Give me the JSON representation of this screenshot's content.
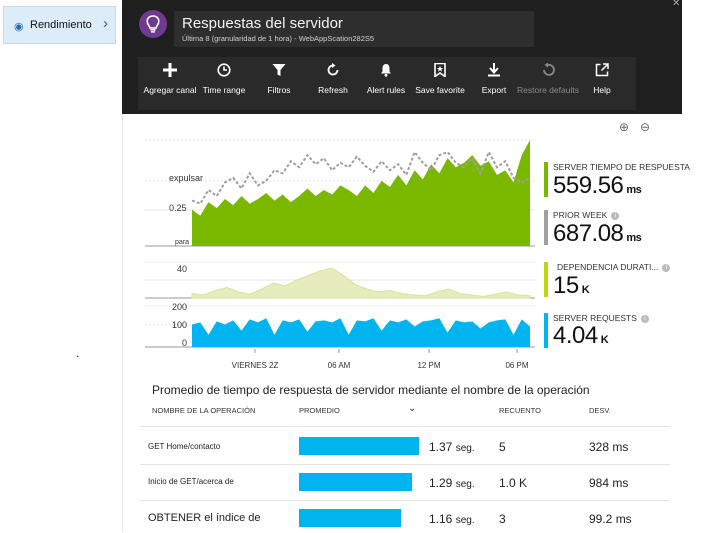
{
  "nav": {
    "item_label": "Rendimiento",
    "icon": "performance-icon"
  },
  "header": {
    "title": "Respuestas del servidor",
    "subtitle": "Última 8 (granularidad de 1 hora) - WebAppScation282S5",
    "app_icon": "lightbulb-icon"
  },
  "toolbar": {
    "items": [
      {
        "label": "Agregar canal",
        "icon": "plus-icon",
        "enabled": true
      },
      {
        "label": "Time range",
        "icon": "clock-icon",
        "enabled": true
      },
      {
        "label": "Filtros",
        "icon": "filter-icon",
        "enabled": true
      },
      {
        "label": "Refresh",
        "icon": "refresh-icon",
        "enabled": true
      },
      {
        "label": "Alert rules",
        "icon": "bell-icon",
        "enabled": true
      },
      {
        "label": "Save favorite",
        "icon": "bookmark-icon",
        "enabled": true
      },
      {
        "label": "Export",
        "icon": "download-icon",
        "enabled": true
      },
      {
        "label": "Restore defaults",
        "icon": "undo-icon",
        "enabled": false
      },
      {
        "label": "Help",
        "icon": "external-link-icon",
        "enabled": true
      }
    ]
  },
  "colors": {
    "green": "#7ab800",
    "gray": "#a0a0a0",
    "lime": "#bad80a",
    "blue": "#00b4f0",
    "lime_fill": "#e7ecbf",
    "header_bg": "#1f1f1f"
  },
  "chart_data": [
    {
      "type": "area",
      "title": "",
      "ytick_labels": [
        "0.25"
      ],
      "annotations": [
        "expulsar",
        "para"
      ],
      "xtick_labels": [
        "VIERNES 2Z",
        "06 AM",
        "12 PM",
        "06 PM"
      ],
      "ylim": [
        0,
        0.7
      ],
      "series": [
        {
          "name": "SERVER TIEMPO DE RESPUESTA",
          "kind": "area",
          "values": [
            0.24,
            0.2,
            0.29,
            0.25,
            0.31,
            0.27,
            0.33,
            0.28,
            0.31,
            0.35,
            0.3,
            0.34,
            0.29,
            0.33,
            0.38,
            0.33,
            0.37,
            0.34,
            0.4,
            0.37,
            0.33,
            0.4,
            0.35,
            0.43,
            0.39,
            0.47,
            0.4,
            0.5,
            0.44,
            0.54,
            0.48,
            0.58,
            0.52,
            0.55,
            0.6,
            0.53,
            0.56,
            0.47,
            0.5,
            0.42,
            0.6,
            0.7
          ]
        },
        {
          "name": "PRIOR WEEK",
          "kind": "dashed",
          "values": [
            0.3,
            0.28,
            0.37,
            0.33,
            0.42,
            0.45,
            0.38,
            0.48,
            0.4,
            0.43,
            0.5,
            0.48,
            0.56,
            0.52,
            0.6,
            0.54,
            0.58,
            0.5,
            0.55,
            0.52,
            0.59,
            0.53,
            0.49,
            0.56,
            0.5,
            0.54,
            0.47,
            0.62,
            0.55,
            0.5,
            0.6,
            0.62,
            0.55,
            0.52,
            0.58,
            0.48,
            0.62,
            0.52,
            0.56,
            0.45,
            0.42,
            0.45
          ]
        }
      ]
    },
    {
      "type": "area",
      "ytick_labels": [
        "40"
      ],
      "series": [
        {
          "name": "DEPENDENCIA DURATI...",
          "values": [
            6,
            4,
            10,
            14,
            8,
            5,
            12,
            20,
            16,
            24,
            30,
            36,
            40,
            30,
            18,
            12,
            8,
            10,
            6,
            4,
            3,
            8,
            12,
            6,
            4,
            2,
            5,
            8,
            4,
            3
          ]
        }
      ]
    },
    {
      "type": "area",
      "ytick_labels": [
        "200",
        "100",
        "0"
      ],
      "series": [
        {
          "name": "SERVER REQUESTS",
          "values": [
            110,
            120,
            60,
            125,
            110,
            130,
            80,
            135,
            120,
            140,
            60,
            130,
            120,
            135,
            75,
            125,
            130,
            120,
            140,
            60,
            130,
            125,
            140,
            80,
            130,
            120,
            135,
            100,
            125,
            130,
            140,
            70,
            130,
            120,
            125,
            90,
            120,
            130,
            135,
            60,
            135,
            100
          ]
        }
      ]
    }
  ],
  "metrics": [
    {
      "label": "SERVER TIEMPO DE RESPUESTA",
      "value": "559.56",
      "unit": "ms"
    },
    {
      "label": "PRIOR WEEK",
      "value": "687.08",
      "unit": "ms"
    },
    {
      "label": "DEPENDENCIA DURATI...",
      "value": "15",
      "unit": "K"
    },
    {
      "label": "SERVER REQUESTS",
      "value": "4.04",
      "unit": "K"
    }
  ],
  "table": {
    "title": "Promedio de tiempo de respuesta de servidor mediante el nombre de la operación",
    "headers": [
      "NOMBRE DE LA OPERACIÓN",
      "PROMEDIO",
      "RECUENTO",
      "DESV."
    ],
    "rows": [
      {
        "name": "GET Home/contacto",
        "avg": "1.37",
        "avg_unit": "seg.",
        "avg_value": 1.37,
        "count": "5",
        "dev": "328 ms"
      },
      {
        "name": "Inicio de GET/acerca de",
        "avg": "1.29",
        "avg_unit": "seg.",
        "avg_value": 1.29,
        "count": "1.0 K",
        "dev": "984 ms"
      },
      {
        "name": "OBTENER el índice de",
        "avg": "1.16",
        "avg_unit": "seg.",
        "avg_value": 1.16,
        "count": "3",
        "dev": "99.2 ms"
      }
    ]
  }
}
